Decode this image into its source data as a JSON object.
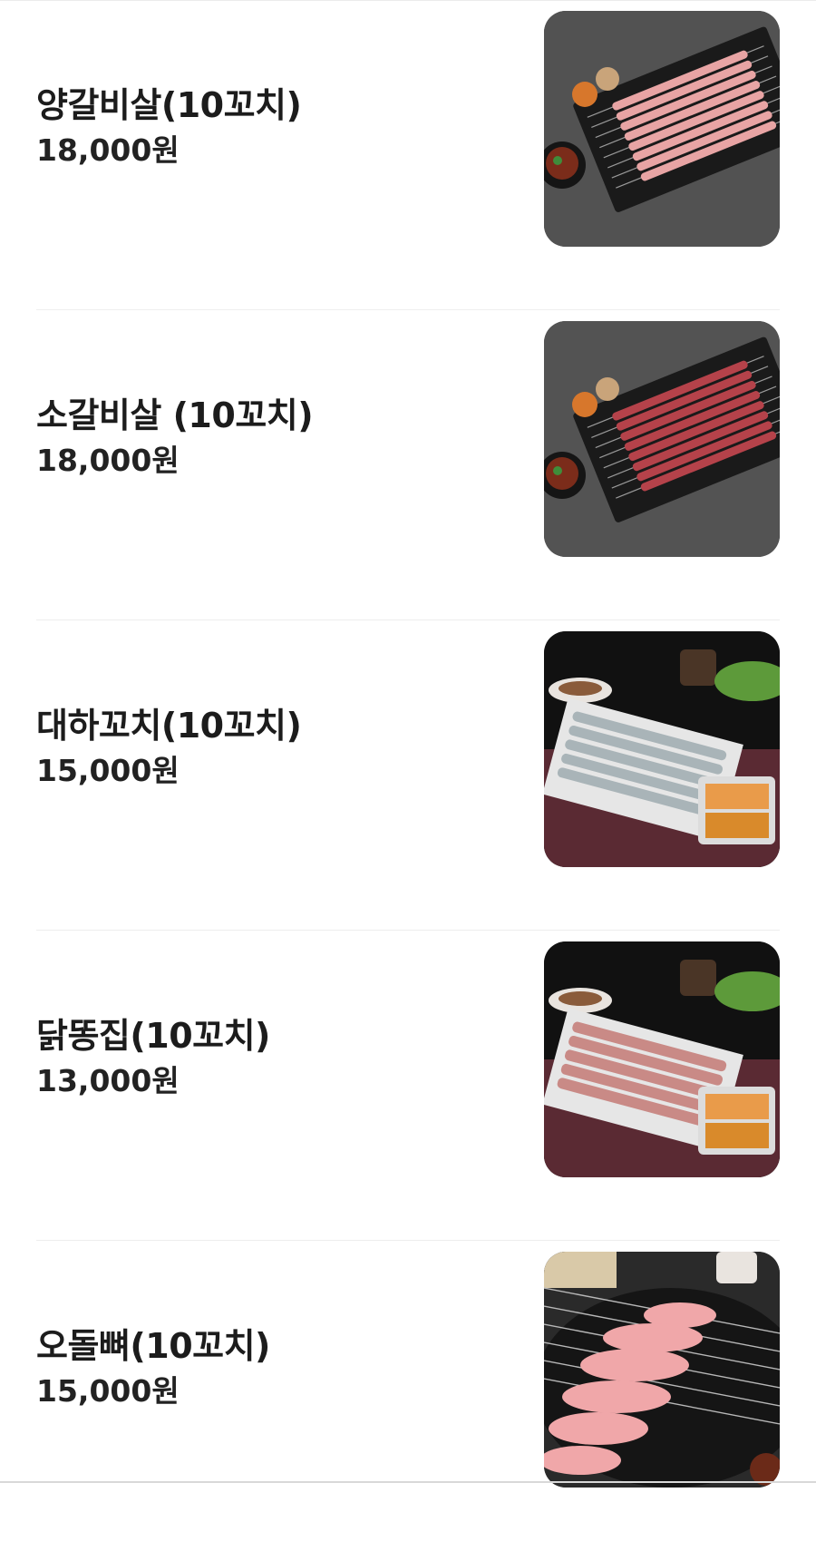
{
  "menu": {
    "items": [
      {
        "name": "양갈비살(10꼬치)",
        "price": "18,000원",
        "photo_icon": "lamb-rib-skewers-photo",
        "photo_theme": "platter-gray",
        "meat_color": "#e8a4a4"
      },
      {
        "name": "소갈비살 (10꼬치)",
        "price": "18,000원",
        "photo_icon": "beef-rib-skewers-photo",
        "photo_theme": "platter-gray",
        "meat_color": "#b5424a"
      },
      {
        "name": "대하꼬치(10꼬치)",
        "price": "15,000원",
        "photo_icon": "shrimp-skewers-photo",
        "photo_theme": "table-dark",
        "meat_color": "#a9b4b8"
      },
      {
        "name": "닭똥집(10꼬치)",
        "price": "13,000원",
        "photo_icon": "chicken-gizzard-skewers-photo",
        "photo_theme": "table-dark",
        "meat_color": "#c98a86"
      },
      {
        "name": "오돌뼈(10꼬치)",
        "price": "15,000원",
        "photo_icon": "pork-cartilage-skewers-photo",
        "photo_theme": "grill-dark",
        "meat_color": "#f0a7a9"
      }
    ]
  }
}
